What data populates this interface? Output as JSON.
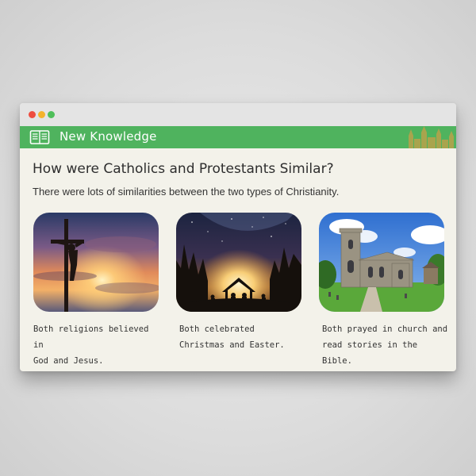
{
  "window": {
    "controls": [
      "close",
      "minimize",
      "maximize"
    ]
  },
  "banner": {
    "title": "New Knowledge",
    "icon": "book-icon",
    "decoration": "cathedral-silhouette",
    "color": "#4fb35e"
  },
  "lesson": {
    "heading": "How were Catholics and Protestants Similar?",
    "subtitle": "There were lots of similarities between the two types of Christianity."
  },
  "cards": [
    {
      "image": "crucifix-sunset-image",
      "line1": "Both religions believed in",
      "line2": "God and Jesus."
    },
    {
      "image": "nativity-scene-image",
      "line1": "Both celebrated",
      "line2": "Christmas and Easter."
    },
    {
      "image": "church-building-image",
      "line1": "Both prayed in church and",
      "line2": "read stories in the Bible."
    }
  ]
}
